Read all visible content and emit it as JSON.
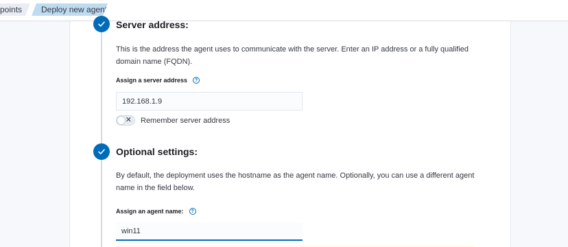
{
  "breadcrumb": {
    "items": [
      {
        "label": "points"
      },
      {
        "label": "Deploy new agent"
      }
    ]
  },
  "steps": [
    {
      "title": "Server address:",
      "description": "This is the address the agent uses to communicate with the server. Enter an IP address or a fully qualified domain name (FQDN).",
      "field_label": "Assign a server address",
      "input_value": "192.168.1.9",
      "toggle_label": "Remember server address",
      "toggle_on": false
    },
    {
      "title": "Optional settings:",
      "description": "By default, the deployment uses the hostname as the agent name. Optionally, you can use a different agent name in the field below.",
      "field_label": "Assign an agent name:",
      "input_value": "win11"
    }
  ],
  "icons": {
    "step_complete": "check-icon",
    "help": "question-circle-icon",
    "toggle_off": "cross-icon"
  },
  "colors": {
    "accent": "#006bb8",
    "breadcrumb_active": "#bfdbf0"
  }
}
